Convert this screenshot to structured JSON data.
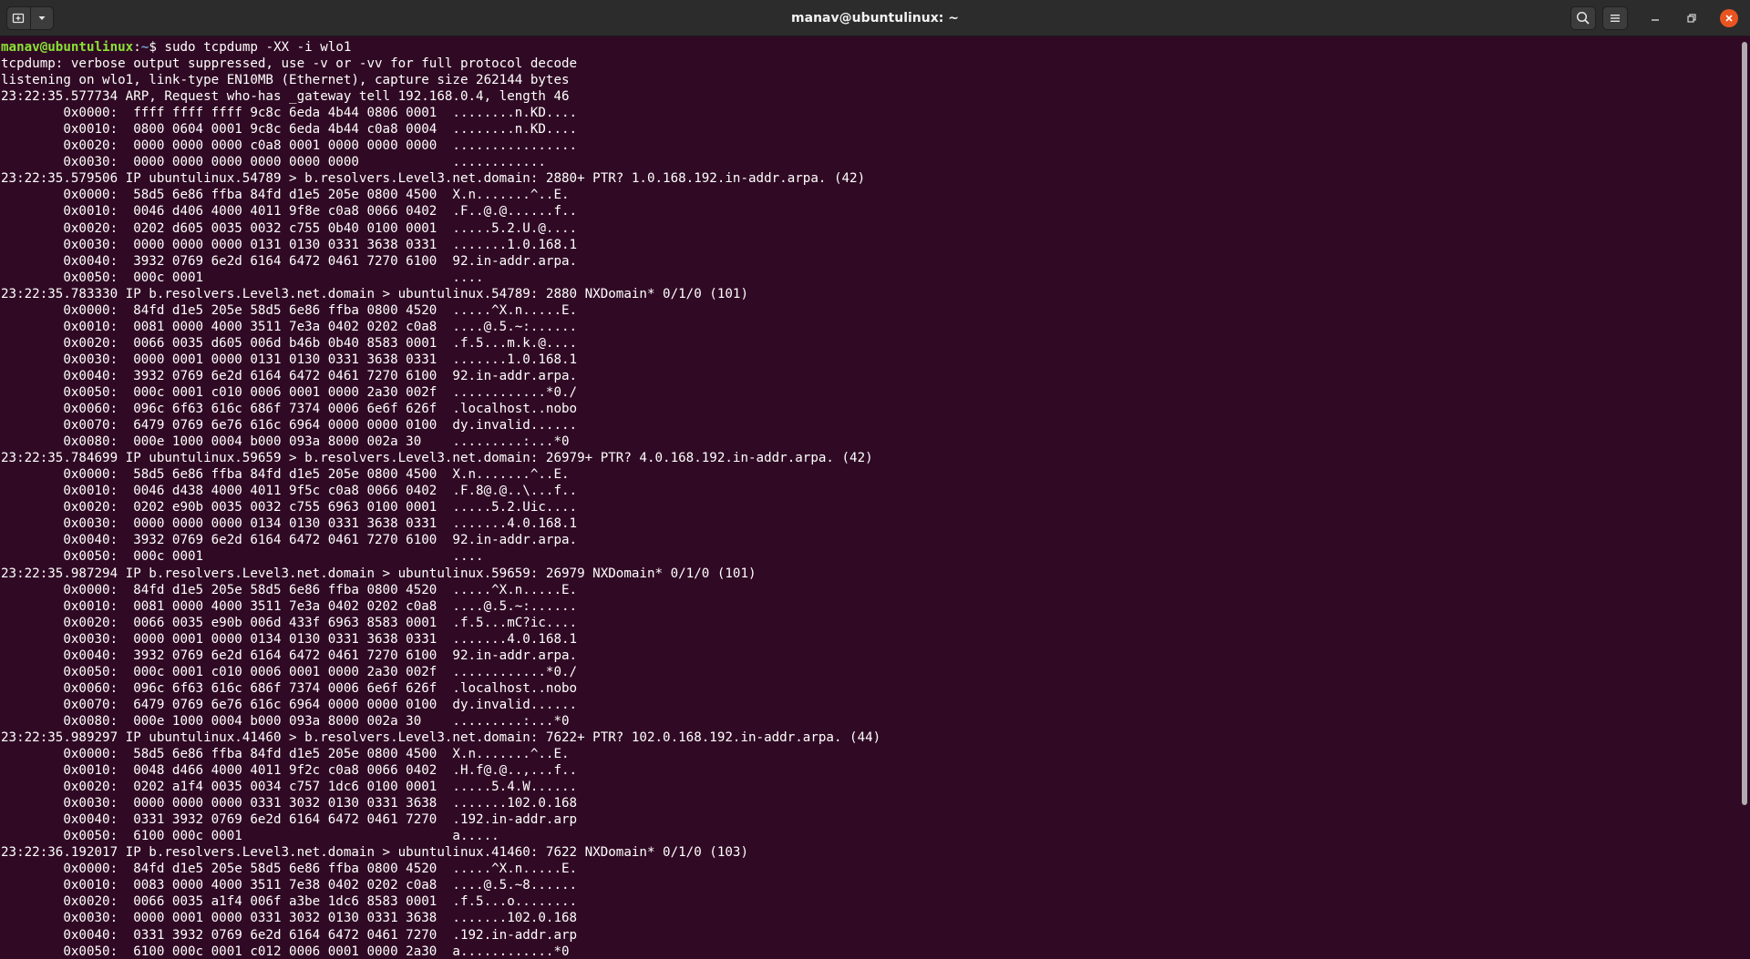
{
  "window": {
    "title": "manav@ubuntulinux: ~",
    "icons": {
      "new_tab": "new-tab-icon",
      "dropdown": "chevron-down-icon",
      "search": "search-icon",
      "menu": "hamburger-menu-icon",
      "minimize": "minimize-icon",
      "maximize": "maximize-icon",
      "close": "close-icon"
    }
  },
  "colors": {
    "terminal_bg": "#300a24",
    "titlebar_bg": "#2c2c2c",
    "prompt_user": "#8ae234",
    "prompt_path": "#729fcf",
    "close_button": "#e95420"
  },
  "terminal": {
    "prompt": {
      "user_host": "manav@ubuntulinux",
      "colon": ":",
      "path": "~",
      "dollar": "$ ",
      "command": "sudo tcpdump -XX -i wlo1"
    },
    "lines": [
      "tcpdump: verbose output suppressed, use -v or -vv for full protocol decode",
      "listening on wlo1, link-type EN10MB (Ethernet), capture size 262144 bytes",
      "23:22:35.577734 ARP, Request who-has _gateway tell 192.168.0.4, length 46",
      "        0x0000:  ffff ffff ffff 9c8c 6eda 4b44 0806 0001  ........n.KD....",
      "        0x0010:  0800 0604 0001 9c8c 6eda 4b44 c0a8 0004  ........n.KD....",
      "        0x0020:  0000 0000 0000 c0a8 0001 0000 0000 0000  ................",
      "        0x0030:  0000 0000 0000 0000 0000 0000            ............",
      "23:22:35.579506 IP ubuntulinux.54789 > b.resolvers.Level3.net.domain: 2880+ PTR? 1.0.168.192.in-addr.arpa. (42)",
      "        0x0000:  58d5 6e86 ffba 84fd d1e5 205e 0800 4500  X.n.......^..E.",
      "        0x0010:  0046 d406 4000 4011 9f8e c0a8 0066 0402  .F..@.@......f..",
      "        0x0020:  0202 d605 0035 0032 c755 0b40 0100 0001  .....5.2.U.@....",
      "        0x0030:  0000 0000 0000 0131 0130 0331 3638 0331  .......1.0.168.1",
      "        0x0040:  3932 0769 6e2d 6164 6472 0461 7270 6100  92.in-addr.arpa.",
      "        0x0050:  000c 0001                                ....",
      "23:22:35.783330 IP b.resolvers.Level3.net.domain > ubuntulinux.54789: 2880 NXDomain* 0/1/0 (101)",
      "        0x0000:  84fd d1e5 205e 58d5 6e86 ffba 0800 4520  .....^X.n.....E.",
      "        0x0010:  0081 0000 4000 3511 7e3a 0402 0202 c0a8  ....@.5.~:......",
      "        0x0020:  0066 0035 d605 006d b46b 0b40 8583 0001  .f.5...m.k.@....",
      "        0x0030:  0000 0001 0000 0131 0130 0331 3638 0331  .......1.0.168.1",
      "        0x0040:  3932 0769 6e2d 6164 6472 0461 7270 6100  92.in-addr.arpa.",
      "        0x0050:  000c 0001 c010 0006 0001 0000 2a30 002f  ............*0./",
      "        0x0060:  096c 6f63 616c 686f 7374 0006 6e6f 626f  .localhost..nobo",
      "        0x0070:  6479 0769 6e76 616c 6964 0000 0000 0100  dy.invalid......",
      "        0x0080:  000e 1000 0004 b000 093a 8000 002a 30    .........:...*0",
      "23:22:35.784699 IP ubuntulinux.59659 > b.resolvers.Level3.net.domain: 26979+ PTR? 4.0.168.192.in-addr.arpa. (42)",
      "        0x0000:  58d5 6e86 ffba 84fd d1e5 205e 0800 4500  X.n.......^..E.",
      "        0x0010:  0046 d438 4000 4011 9f5c c0a8 0066 0402  .F.8@.@..\\...f..",
      "        0x0020:  0202 e90b 0035 0032 c755 6963 0100 0001  .....5.2.Uic....",
      "        0x0030:  0000 0000 0000 0134 0130 0331 3638 0331  .......4.0.168.1",
      "        0x0040:  3932 0769 6e2d 6164 6472 0461 7270 6100  92.in-addr.arpa.",
      "        0x0050:  000c 0001                                ....",
      "23:22:35.987294 IP b.resolvers.Level3.net.domain > ubuntulinux.59659: 26979 NXDomain* 0/1/0 (101)",
      "        0x0000:  84fd d1e5 205e 58d5 6e86 ffba 0800 4520  .....^X.n.....E.",
      "        0x0010:  0081 0000 4000 3511 7e3a 0402 0202 c0a8  ....@.5.~:......",
      "        0x0020:  0066 0035 e90b 006d 433f 6963 8583 0001  .f.5...mC?ic....",
      "        0x0030:  0000 0001 0000 0134 0130 0331 3638 0331  .......4.0.168.1",
      "        0x0040:  3932 0769 6e2d 6164 6472 0461 7270 6100  92.in-addr.arpa.",
      "        0x0050:  000c 0001 c010 0006 0001 0000 2a30 002f  ............*0./",
      "        0x0060:  096c 6f63 616c 686f 7374 0006 6e6f 626f  .localhost..nobo",
      "        0x0070:  6479 0769 6e76 616c 6964 0000 0000 0100  dy.invalid......",
      "        0x0080:  000e 1000 0004 b000 093a 8000 002a 30    .........:...*0",
      "23:22:35.989297 IP ubuntulinux.41460 > b.resolvers.Level3.net.domain: 7622+ PTR? 102.0.168.192.in-addr.arpa. (44)",
      "        0x0000:  58d5 6e86 ffba 84fd d1e5 205e 0800 4500  X.n.......^..E.",
      "        0x0010:  0048 d466 4000 4011 9f2c c0a8 0066 0402  .H.f@.@..,...f..",
      "        0x0020:  0202 a1f4 0035 0034 c757 1dc6 0100 0001  .....5.4.W......",
      "        0x0030:  0000 0000 0000 0331 3032 0130 0331 3638  .......102.0.168",
      "        0x0040:  0331 3932 0769 6e2d 6164 6472 0461 7270  .192.in-addr.arp",
      "        0x0050:  6100 000c 0001                           a.....",
      "23:22:36.192017 IP b.resolvers.Level3.net.domain > ubuntulinux.41460: 7622 NXDomain* 0/1/0 (103)",
      "        0x0000:  84fd d1e5 205e 58d5 6e86 ffba 0800 4520  .....^X.n.....E.",
      "        0x0010:  0083 0000 4000 3511 7e38 0402 0202 c0a8  ....@.5.~8......",
      "        0x0020:  0066 0035 a1f4 006f a3be 1dc6 8583 0001  .f.5...o........",
      "        0x0030:  0000 0001 0000 0331 3032 0130 0331 3638  .......102.0.168",
      "        0x0040:  0331 3932 0769 6e2d 6164 6472 0461 7270  .192.in-addr.arp",
      "        0x0050:  6100 000c 0001 c012 0006 0001 0000 2a30  a............*0"
    ]
  }
}
